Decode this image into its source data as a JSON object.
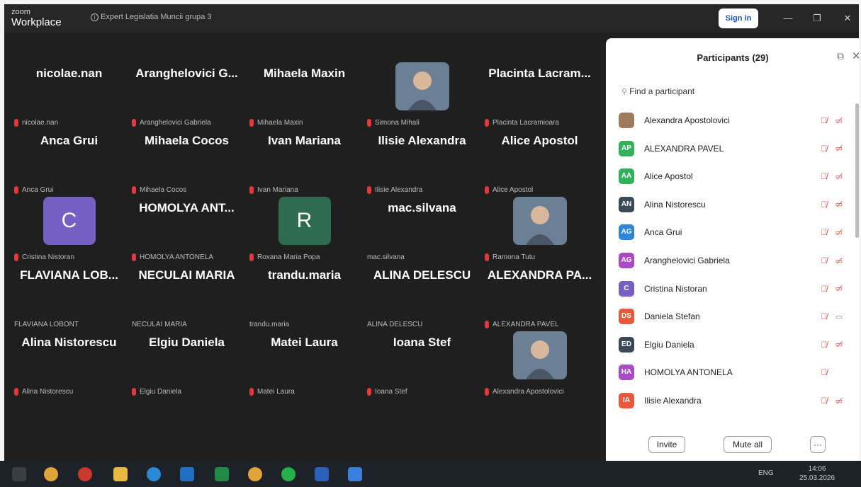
{
  "titlebar": {
    "logo_small": "zoom",
    "logo_big": "Workplace",
    "meeting_title": "Expert Legislatia Muncii grupa 3",
    "sign_in": "Sign in",
    "minimize": "—",
    "maximize": "❐",
    "close": "✕"
  },
  "gallery": {
    "tiles": [
      {
        "name": "nicolae.nan",
        "label": "nicolae.nan",
        "type": "text",
        "muted": true
      },
      {
        "name": "Aranghelovici G...",
        "label": "Aranghelovici Gabriela",
        "type": "text",
        "muted": true
      },
      {
        "name": "Mihaela Maxin",
        "label": "Mihaela Maxin",
        "type": "text",
        "muted": true
      },
      {
        "name": "",
        "label": "Simona Mihali",
        "type": "photo",
        "muted": true
      },
      {
        "name": "Placinta Lacram...",
        "label": "Placinta Lacramioara",
        "type": "text",
        "muted": true
      },
      {
        "name": "Anca Grui",
        "label": "Anca Grui",
        "type": "text",
        "muted": true
      },
      {
        "name": "Mihaela Cocos",
        "label": "Mihaela Cocos",
        "type": "text",
        "muted": true
      },
      {
        "name": "Ivan Mariana",
        "label": "Ivan Mariana",
        "type": "text",
        "muted": true
      },
      {
        "name": "Ilisie Alexandra",
        "label": "Ilisie Alexandra",
        "type": "text",
        "muted": true
      },
      {
        "name": "Alice Apostol",
        "label": "Alice Apostol",
        "type": "text",
        "muted": true
      },
      {
        "name": "C",
        "label": "Cristina Nistoran",
        "type": "avatar",
        "color": "#7660c4",
        "muted": true
      },
      {
        "name": "HOMOLYA ANT...",
        "label": "HOMOLYA ANTONELA",
        "type": "text",
        "muted": true
      },
      {
        "name": "R",
        "label": "Roxana Maria Popa",
        "type": "avatar",
        "color": "#2f6b4f",
        "muted": true
      },
      {
        "name": "mac.silvana",
        "label": "mac.silvana",
        "type": "text",
        "muted": false
      },
      {
        "name": "",
        "label": "Ramona Tutu",
        "type": "photo",
        "muted": true
      },
      {
        "name": "FLAVIANA LOB...",
        "label": "FLAVIANA LOBONT",
        "type": "text",
        "muted": false
      },
      {
        "name": "NECULAI MARIA",
        "label": "NECULAI MARIA",
        "type": "text",
        "muted": false
      },
      {
        "name": "trandu.maria",
        "label": "trandu.maria",
        "type": "text",
        "muted": false
      },
      {
        "name": "ALINA DELESCU",
        "label": "ALINA DELESCU",
        "type": "text",
        "muted": false
      },
      {
        "name": "ALEXANDRA PA...",
        "label": "ALEXANDRA PAVEL",
        "type": "text",
        "muted": true
      },
      {
        "name": "Alina Nistorescu",
        "label": "Alina Nistorescu",
        "type": "text",
        "muted": true
      },
      {
        "name": "Elgiu Daniela",
        "label": "Elgiu Daniela",
        "type": "text",
        "muted": true
      },
      {
        "name": "Matei Laura",
        "label": "Matei Laura",
        "type": "text",
        "muted": true
      },
      {
        "name": "Ioana Stef",
        "label": "Ioana Stef",
        "type": "text",
        "muted": true
      },
      {
        "name": "",
        "label": "Alexandra Apostolovici",
        "type": "photo",
        "muted": true
      }
    ]
  },
  "participants": {
    "title": "Participants (29)",
    "search_placeholder": "Find a participant",
    "list": [
      {
        "initials": "",
        "name": "Alexandra Apostolovici",
        "color": "#a07a5c",
        "mic": "off",
        "cam": "off"
      },
      {
        "initials": "AP",
        "name": "ALEXANDRA PAVEL",
        "color": "#2fb25a",
        "mic": "off",
        "cam": "off"
      },
      {
        "initials": "AA",
        "name": "Alice Apostol",
        "color": "#2fb25a",
        "mic": "off",
        "cam": "off"
      },
      {
        "initials": "AN",
        "name": "Alina Nistorescu",
        "color": "#3b4a5a",
        "mic": "off",
        "cam": "off"
      },
      {
        "initials": "AG",
        "name": "Anca Grui",
        "color": "#2d86d8",
        "mic": "off",
        "cam": "off"
      },
      {
        "initials": "AG",
        "name": "Aranghelovici Gabriela",
        "color": "#a94bc6",
        "mic": "off",
        "cam": "off"
      },
      {
        "initials": "C",
        "name": "Cristina Nistoran",
        "color": "#7660c4",
        "mic": "off",
        "cam": "off"
      },
      {
        "initials": "DS",
        "name": "Daniela Stefan",
        "color": "#e8583a",
        "mic": "off",
        "cam": "on"
      },
      {
        "initials": "ED",
        "name": "Elgiu Daniela",
        "color": "#3b4a5a",
        "mic": "off",
        "cam": "off"
      },
      {
        "initials": "HA",
        "name": "HOMOLYA ANTONELA",
        "color": "#a94bc6",
        "mic": "off",
        "cam": "none"
      },
      {
        "initials": "IA",
        "name": "Ilisie Alexandra",
        "color": "#e8583a",
        "mic": "off",
        "cam": "off"
      }
    ],
    "invite": "Invite",
    "mute_all": "Mute all",
    "more": "···"
  },
  "taskbar": {
    "lang": "ENG",
    "time": "14:06",
    "date": "25.03.2026"
  },
  "colors": {
    "muted_red": "#e23a3a",
    "app_bg": "#1f1f1f",
    "signin_blue": "#1a55c2"
  }
}
